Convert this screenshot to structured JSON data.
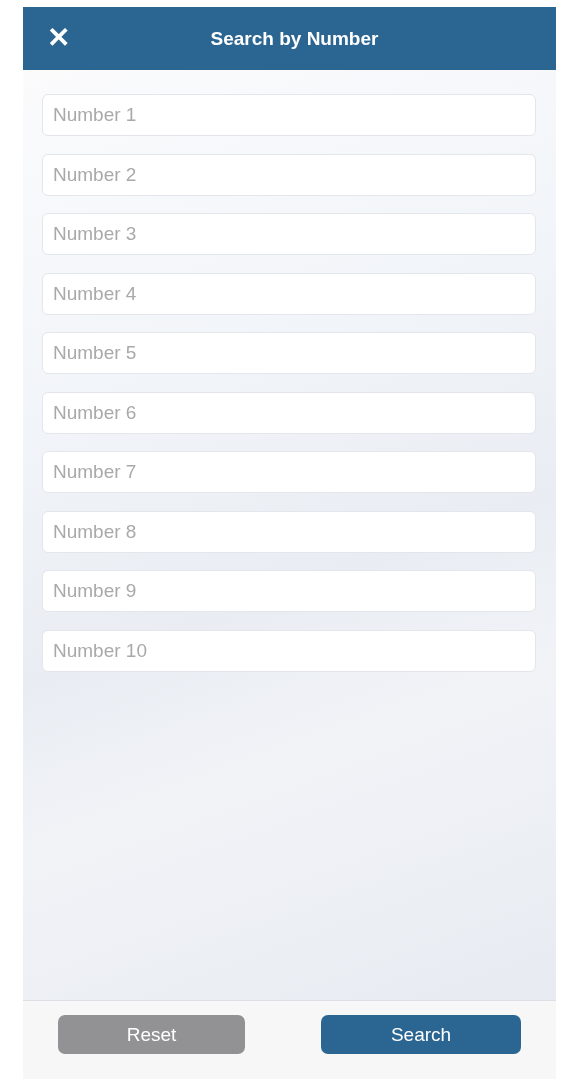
{
  "header": {
    "close_icon": "✕",
    "title": "Search by Number"
  },
  "fields": [
    {
      "placeholder": "Number 1"
    },
    {
      "placeholder": "Number 2"
    },
    {
      "placeholder": "Number 3"
    },
    {
      "placeholder": "Number 4"
    },
    {
      "placeholder": "Number 5"
    },
    {
      "placeholder": "Number 6"
    },
    {
      "placeholder": "Number 7"
    },
    {
      "placeholder": "Number 8"
    },
    {
      "placeholder": "Number 9"
    },
    {
      "placeholder": "Number 10"
    }
  ],
  "buttons": [
    {
      "kind": "secondary",
      "label": "Reset"
    },
    {
      "kind": "primary",
      "label": "Search"
    }
  ]
}
